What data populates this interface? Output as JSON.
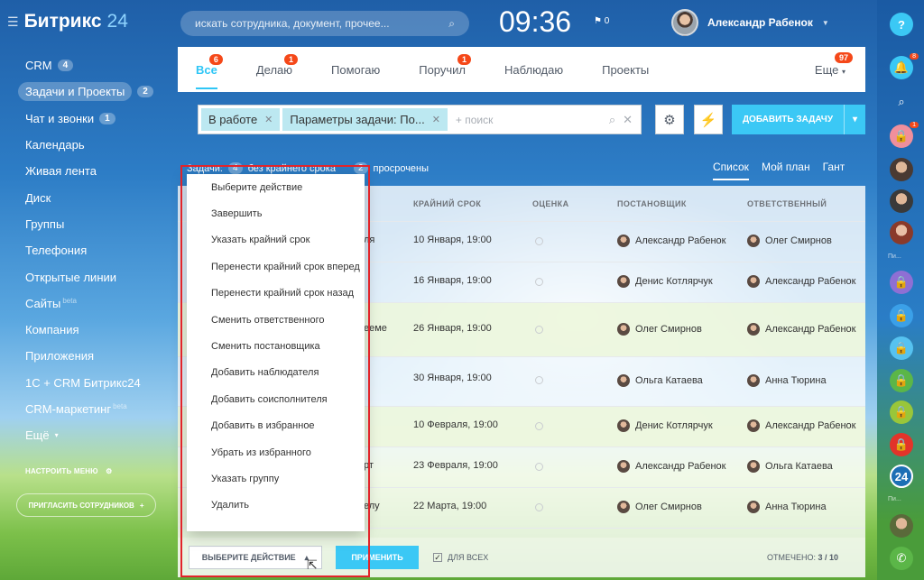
{
  "header": {
    "logo": "Битрикс",
    "logo_num": "24",
    "search_placeholder": "искать сотрудника, документ, прочее...",
    "clock": "09:36",
    "flag_count": "0",
    "user_name": "Александр Рабенок"
  },
  "sidebar": {
    "items": [
      {
        "label": "CRM",
        "count": "4"
      },
      {
        "label": "Задачи и Проекты",
        "count": "2"
      },
      {
        "label": "Чат и звонки",
        "count": "1"
      },
      {
        "label": "Календарь"
      },
      {
        "label": "Живая лента"
      },
      {
        "label": "Диск"
      },
      {
        "label": "Группы"
      },
      {
        "label": "Телефония"
      },
      {
        "label": "Открытые линии"
      },
      {
        "label": "Сайты",
        "beta": "beta"
      },
      {
        "label": "Компания"
      },
      {
        "label": "Приложения"
      },
      {
        "label": "1С + CRM Битрикс24"
      },
      {
        "label": "CRM-маркетинг",
        "beta": "beta"
      },
      {
        "label": "Ещё"
      }
    ],
    "setup_menu": "НАСТРОИТЬ МЕНЮ",
    "invite": "ПРИГЛАСИТЬ СОТРУДНИКОВ"
  },
  "tabs": [
    {
      "label": "Все",
      "badge": "6"
    },
    {
      "label": "Делаю",
      "badge": "1"
    },
    {
      "label": "Помогаю"
    },
    {
      "label": "Поручил",
      "badge": "1"
    },
    {
      "label": "Наблюдаю"
    },
    {
      "label": "Проекты"
    }
  ],
  "tabs_more": "Еще",
  "tabs_more_badge": "97",
  "filter": {
    "chip1": "В работе",
    "chip2": "Параметры задачи: По...",
    "placeholder": "+ поиск"
  },
  "add_task": "ДОБАВИТЬ ЗАДАЧУ",
  "counters": {
    "label": "Задачи:",
    "n1": "4",
    "t1": "без крайнего срока",
    "n2": "2",
    "t2": "просрочены"
  },
  "views": [
    "Список",
    "Мой план",
    "Гант"
  ],
  "columns": {
    "deadline": "КРАЙНИЙ СРОК",
    "rating": "ОЦЕНКА",
    "creator": "ПОСТАНОВЩИК",
    "responsible": "ОТВЕТСТВЕННЫЙ"
  },
  "rows": [
    {
      "frag": "ля",
      "deadline": "10 Января, 19:00",
      "creator": "Александр Рабенок",
      "resp": "Олег Смирнов"
    },
    {
      "frag": "",
      "deadline": "16 Января, 19:00",
      "creator": "Денис Котлярчук",
      "resp": "Александр Рабенок"
    },
    {
      "frag": "ееме",
      "deadline": "26 Января, 19:00",
      "creator": "Олег Смирнов",
      "resp": "Александр Рабенок"
    },
    {
      "frag": "",
      "deadline": "30 Января, 19:00",
      "creator": "Ольга Катаева",
      "resp": "Анна Тюрина"
    },
    {
      "frag": "",
      "deadline": "10 Февраля, 19:00",
      "creator": "Денис Котлярчук",
      "resp": "Александр Рабенок"
    },
    {
      "frag": "рт",
      "deadline": "23 Февраля, 19:00",
      "creator": "Александр Рабенок",
      "resp": "Ольга Катаева"
    },
    {
      "frag": "елу",
      "deadline": "22 Марта, 19:00",
      "creator": "Олег Смирнов",
      "resp": "Анна Тюрина"
    }
  ],
  "dropdown": [
    "Выберите действие",
    "Завершить",
    "Указать крайний срок",
    "Перенести крайний срок вперед",
    "Перенести крайний срок назад",
    "Сменить ответственного",
    "Сменить постановщика",
    "Добавить наблюдателя",
    "Добавить соисполнителя",
    "Добавить в избранное",
    "Убрать из избранного",
    "Указать группу",
    "Удалить"
  ],
  "footer": {
    "select_action": "ВЫБЕРИТЕ ДЕЙСТВИЕ",
    "apply": "ПРИМЕНИТЬ",
    "for_all": "ДЛЯ ВСЕХ",
    "marked_label": "ОТМЕЧЕНО:",
    "marked_value": "3 / 10"
  },
  "right_bar": {
    "notif_badge": "8",
    "lock_badge": "1",
    "label1": "Пи...",
    "label2": "Пи...",
    "logo24": "24"
  },
  "colors": {
    "accent": "#3bc8f5",
    "badge": "#f54819",
    "highlight": "#e2242a"
  }
}
